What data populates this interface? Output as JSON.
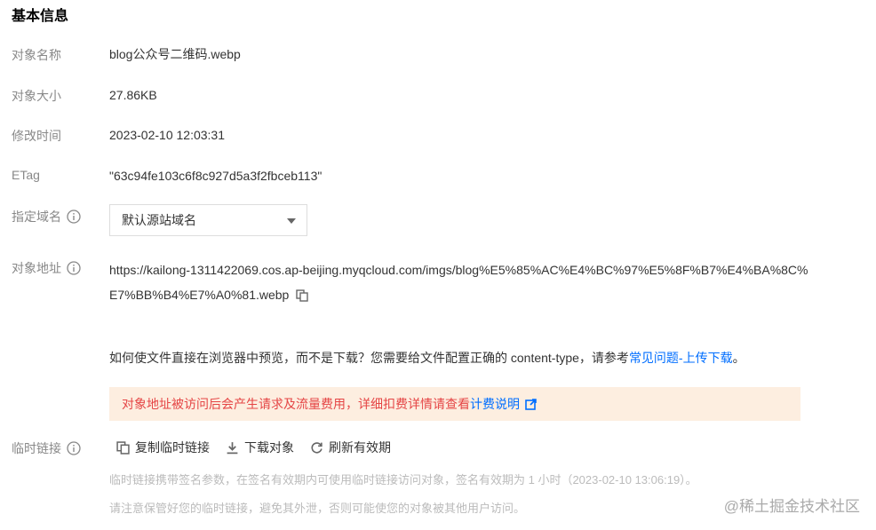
{
  "section_title": "基本信息",
  "fields": {
    "name": {
      "label": "对象名称",
      "value": "blog公众号二维码.webp"
    },
    "size": {
      "label": "对象大小",
      "value": "27.86KB"
    },
    "modified": {
      "label": "修改时间",
      "value": "2023-02-10 12:03:31"
    },
    "etag": {
      "label": "ETag",
      "value": "\"63c94fe103c6f8c927d5a3f2fbceb113\""
    },
    "domain": {
      "label": "指定域名",
      "selected": "默认源站域名"
    },
    "address": {
      "label": "对象地址",
      "url": "https://kailong-1311422069.cos.ap-beijing.myqcloud.com/imgs/blog%E5%85%AC%E4%BC%97%E5%8F%B7%E4%BA%8C%E7%BB%B4%E7%A0%81.webp",
      "hint_text": "如何使文件直接在浏览器中预览，而不是下载？您需要给文件配置正确的 content-type，请参考",
      "hint_link": "常见问题-上传下载",
      "hint_end": "。",
      "warning_text": "对象地址被访问后会产生请求及流量费用，详细扣费详情请查看",
      "warning_link": "计费说明"
    },
    "temp_link": {
      "label": "临时链接",
      "copy_label": "复制临时链接",
      "download_label": "下载对象",
      "refresh_label": "刷新有效期",
      "note1": "临时链接携带签名参数，在签名有效期内可使用临时链接访问对象，签名有效期为 1 小时（2023-02-10 13:06:19）。",
      "note2": "请注意保管好您的临时链接，避免其外泄，否则可能使您的对象被其他用户访问。"
    }
  },
  "watermark": "@稀土掘金技术社区",
  "colors": {
    "link": "#006eff",
    "warning_bg": "#fdeee0",
    "warning_text": "#e54545"
  }
}
